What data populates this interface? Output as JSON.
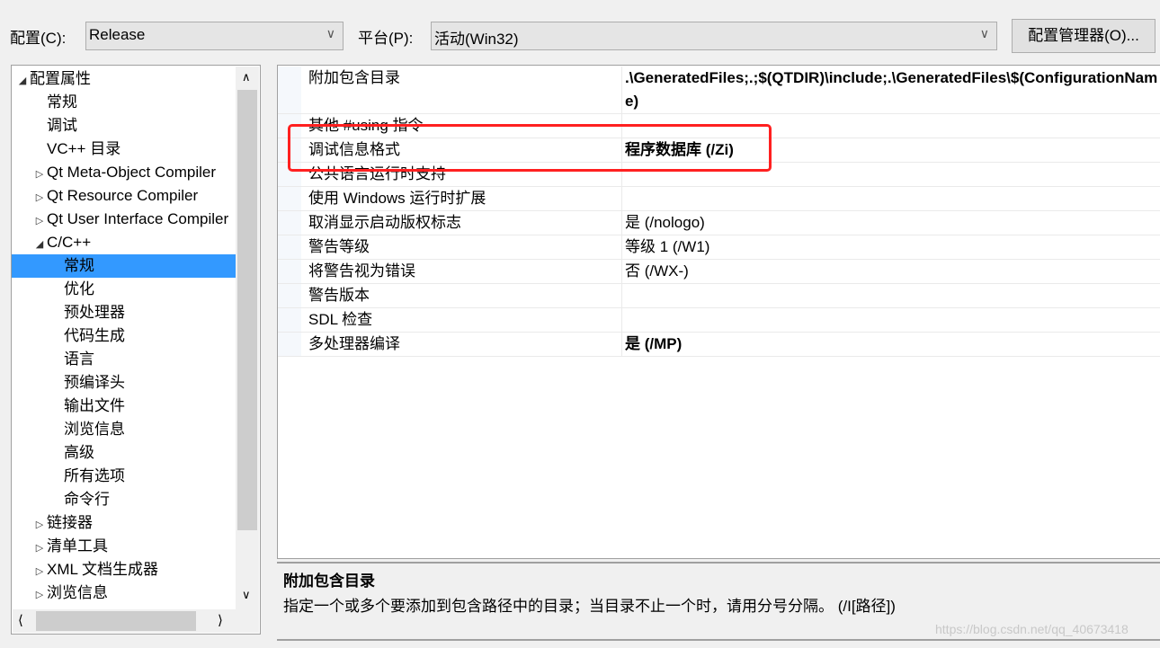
{
  "toolbar": {
    "config_label": "配置(C):",
    "config_value": "Release",
    "platform_label": "平台(P):",
    "platform_value": "活动(Win32)",
    "manager_button": "配置管理器(O)..."
  },
  "tree": {
    "items": [
      {
        "label": "配置属性",
        "level": 0,
        "expander": "expanded"
      },
      {
        "label": "常规",
        "level": 1
      },
      {
        "label": "调试",
        "level": 1
      },
      {
        "label": "VC++ 目录",
        "level": 1
      },
      {
        "label": "Qt Meta-Object Compiler",
        "level": 1,
        "expander": "collapsed"
      },
      {
        "label": "Qt Resource Compiler",
        "level": 1,
        "expander": "collapsed"
      },
      {
        "label": "Qt User Interface Compiler",
        "level": 1,
        "expander": "collapsed"
      },
      {
        "label": "C/C++",
        "level": 1,
        "expander": "expanded"
      },
      {
        "label": "常规",
        "level": 2,
        "selected": true
      },
      {
        "label": "优化",
        "level": 2
      },
      {
        "label": "预处理器",
        "level": 2
      },
      {
        "label": "代码生成",
        "level": 2
      },
      {
        "label": "语言",
        "level": 2
      },
      {
        "label": "预编译头",
        "level": 2
      },
      {
        "label": "输出文件",
        "level": 2
      },
      {
        "label": "浏览信息",
        "level": 2
      },
      {
        "label": "高级",
        "level": 2
      },
      {
        "label": "所有选项",
        "level": 2
      },
      {
        "label": "命令行",
        "level": 2
      },
      {
        "label": "链接器",
        "level": 1,
        "expander": "collapsed"
      },
      {
        "label": "清单工具",
        "level": 1,
        "expander": "collapsed"
      },
      {
        "label": "XML 文档生成器",
        "level": 1,
        "expander": "collapsed"
      },
      {
        "label": "浏览信息",
        "level": 1,
        "expander": "collapsed"
      }
    ]
  },
  "properties": [
    {
      "name": "附加包含目录",
      "value": ".\\GeneratedFiles;.;$(QTDIR)\\include;.\\GeneratedFiles\\$(ConfigurationName)",
      "bold": true
    },
    {
      "name": "其他 #using 指令",
      "value": ""
    },
    {
      "name": "调试信息格式",
      "value": "程序数据库 (/Zi)",
      "bold": true
    },
    {
      "name": "公共语言运行时支持",
      "value": ""
    },
    {
      "name": "使用 Windows 运行时扩展",
      "value": ""
    },
    {
      "name": "取消显示启动版权标志",
      "value": "是 (/nologo)"
    },
    {
      "name": "警告等级",
      "value": "等级 1 (/W1)"
    },
    {
      "name": "将警告视为错误",
      "value": "否 (/WX-)"
    },
    {
      "name": "警告版本",
      "value": ""
    },
    {
      "name": "SDL 检查",
      "value": ""
    },
    {
      "name": "多处理器编译",
      "value": "是 (/MP)",
      "bold": true
    }
  ],
  "description": {
    "title": "附加包含目录",
    "text": "指定一个或多个要添加到包含路径中的目录；当目录不止一个时，请用分号分隔。     (/I[路径])"
  },
  "highlight_color": "#ff2020",
  "selection_color": "#3399ff",
  "watermark": "https://blog.csdn.net/qq_40673418"
}
